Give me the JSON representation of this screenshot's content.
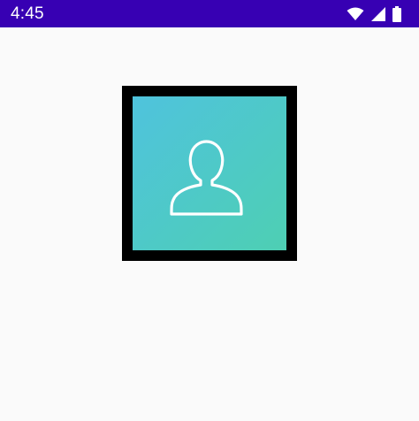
{
  "status_bar": {
    "time": "4:45",
    "icons": [
      "wifi-icon",
      "cellular-signal-icon",
      "battery-icon"
    ],
    "background": "#3700b3"
  },
  "avatar": {
    "icon": "person-icon",
    "border_color": "#000000",
    "gradient": [
      "#4fc3dd",
      "#4ecfb3"
    ]
  },
  "page": {
    "background": "#fafafa"
  }
}
